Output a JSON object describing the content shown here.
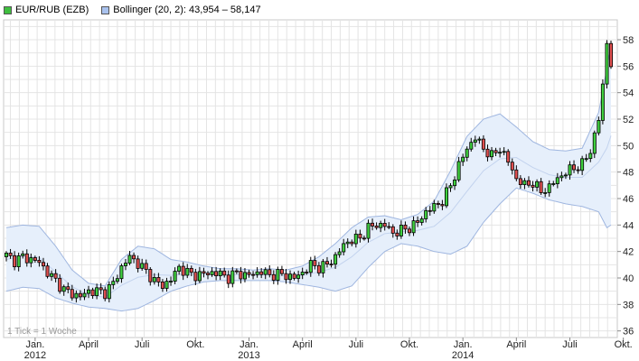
{
  "legend": {
    "series_label": "EUR/RUB (EZB)",
    "bollinger_label": "Bollinger (20, 2): 43,954 – 58,147",
    "series_color": "#3fbf3f",
    "bollinger_color": "#a9c2ee"
  },
  "footnote": "1 Tick = 1 Woche",
  "chart_data": {
    "type": "candlestick",
    "series_name": "EUR/RUB (EZB)",
    "indicator": "Bollinger (20, 2)",
    "indicator_range": [
      43.954,
      58.147
    ],
    "y_axis_side": "right",
    "ylim": [
      35.5,
      59.5
    ],
    "yticks": [
      36,
      38,
      40,
      42,
      44,
      46,
      48,
      50,
      52,
      54,
      56,
      58
    ],
    "ytick_labels": [
      "36",
      "38",
      "40",
      "42",
      "44",
      "46",
      "48",
      "50",
      "52",
      "54",
      "56",
      "58"
    ],
    "xlim": [
      0,
      147
    ],
    "xticks": [
      {
        "x": 7,
        "label": "Jan.",
        "year": "2012"
      },
      {
        "x": 20,
        "label": "April",
        "year": ""
      },
      {
        "x": 33,
        "label": "Juli",
        "year": ""
      },
      {
        "x": 46,
        "label": "Okt.",
        "year": ""
      },
      {
        "x": 59,
        "label": "Jan.",
        "year": "2013"
      },
      {
        "x": 72,
        "label": "April",
        "year": ""
      },
      {
        "x": 85,
        "label": "Juli",
        "year": ""
      },
      {
        "x": 98,
        "label": "Okt.",
        "year": ""
      },
      {
        "x": 111,
        "label": "Jan.",
        "year": "2014"
      },
      {
        "x": 124,
        "label": "April",
        "year": ""
      },
      {
        "x": 137,
        "label": "Juli",
        "year": ""
      },
      {
        "x": 150,
        "label": "Okt.",
        "year": ""
      }
    ],
    "grid": true,
    "up_color": "#3fcf3f",
    "down_color": "#e05050",
    "band_fill": "#e6effb",
    "band_edge": "#9fb6e0",
    "close_anchors": [
      [
        0,
        41.7
      ],
      [
        2,
        41.3
      ],
      [
        4,
        41.6
      ],
      [
        6,
        41.4
      ],
      [
        8,
        41.2
      ],
      [
        10,
        40.4
      ],
      [
        12,
        39.8
      ],
      [
        14,
        39.1
      ],
      [
        16,
        38.8
      ],
      [
        18,
        38.6
      ],
      [
        20,
        39.0
      ],
      [
        22,
        39.0
      ],
      [
        24,
        38.9
      ],
      [
        26,
        39.6
      ],
      [
        28,
        40.8
      ],
      [
        30,
        41.6
      ],
      [
        32,
        41.1
      ],
      [
        34,
        40.5
      ],
      [
        36,
        39.8
      ],
      [
        38,
        39.4
      ],
      [
        40,
        39.9
      ],
      [
        42,
        40.8
      ],
      [
        44,
        40.4
      ],
      [
        46,
        40.2
      ],
      [
        48,
        40.3
      ],
      [
        50,
        40.4
      ],
      [
        52,
        40.3
      ],
      [
        54,
        40.0
      ],
      [
        56,
        40.4
      ],
      [
        58,
        40.2
      ],
      [
        60,
        40.3
      ],
      [
        62,
        40.5
      ],
      [
        64,
        40.2
      ],
      [
        66,
        40.3
      ],
      [
        68,
        40.2
      ],
      [
        70,
        40.0
      ],
      [
        72,
        40.4
      ],
      [
        74,
        41.0
      ],
      [
        76,
        40.8
      ],
      [
        78,
        41.0
      ],
      [
        80,
        41.6
      ],
      [
        82,
        42.5
      ],
      [
        84,
        42.9
      ],
      [
        86,
        43.0
      ],
      [
        88,
        43.8
      ],
      [
        90,
        44.0
      ],
      [
        92,
        44.0
      ],
      [
        94,
        43.4
      ],
      [
        96,
        43.6
      ],
      [
        98,
        43.8
      ],
      [
        100,
        44.2
      ],
      [
        102,
        45.0
      ],
      [
        104,
        45.4
      ],
      [
        106,
        45.8
      ],
      [
        108,
        47.0
      ],
      [
        110,
        48.5
      ],
      [
        112,
        49.8
      ],
      [
        114,
        50.6
      ],
      [
        116,
        49.8
      ],
      [
        118,
        49.2
      ],
      [
        120,
        49.8
      ],
      [
        122,
        48.8
      ],
      [
        124,
        47.5
      ],
      [
        126,
        47.0
      ],
      [
        128,
        47.2
      ],
      [
        130,
        46.5
      ],
      [
        132,
        46.9
      ],
      [
        134,
        47.5
      ],
      [
        136,
        48.0
      ],
      [
        138,
        48.3
      ],
      [
        140,
        48.6
      ],
      [
        142,
        49.6
      ],
      [
        144,
        52.0
      ],
      [
        145,
        54.5
      ],
      [
        146,
        57.8
      ],
      [
        147,
        56.2
      ]
    ],
    "upper_band_anchors": [
      [
        0,
        43.8
      ],
      [
        4,
        44.0
      ],
      [
        8,
        43.9
      ],
      [
        12,
        42.4
      ],
      [
        16,
        40.6
      ],
      [
        20,
        39.6
      ],
      [
        24,
        39.4
      ],
      [
        28,
        41.4
      ],
      [
        32,
        42.4
      ],
      [
        36,
        42.2
      ],
      [
        40,
        41.4
      ],
      [
        44,
        41.2
      ],
      [
        48,
        40.9
      ],
      [
        52,
        40.7
      ],
      [
        56,
        40.7
      ],
      [
        60,
        40.6
      ],
      [
        64,
        40.7
      ],
      [
        68,
        40.6
      ],
      [
        72,
        40.9
      ],
      [
        76,
        41.6
      ],
      [
        80,
        42.6
      ],
      [
        84,
        43.8
      ],
      [
        88,
        44.6
      ],
      [
        92,
        44.7
      ],
      [
        96,
        44.4
      ],
      [
        100,
        44.8
      ],
      [
        104,
        45.8
      ],
      [
        108,
        48.1
      ],
      [
        112,
        50.7
      ],
      [
        116,
        52.0
      ],
      [
        120,
        52.4
      ],
      [
        124,
        51.4
      ],
      [
        128,
        50.3
      ],
      [
        132,
        49.7
      ],
      [
        136,
        49.6
      ],
      [
        140,
        49.8
      ],
      [
        144,
        52.5
      ],
      [
        147,
        57.5
      ]
    ],
    "lower_band_anchors": [
      [
        0,
        39.0
      ],
      [
        4,
        39.3
      ],
      [
        8,
        39.2
      ],
      [
        12,
        38.5
      ],
      [
        16,
        38.1
      ],
      [
        20,
        37.8
      ],
      [
        24,
        37.7
      ],
      [
        28,
        37.5
      ],
      [
        32,
        37.7
      ],
      [
        36,
        38.3
      ],
      [
        40,
        39.0
      ],
      [
        44,
        39.4
      ],
      [
        48,
        39.7
      ],
      [
        52,
        39.8
      ],
      [
        56,
        39.8
      ],
      [
        60,
        39.8
      ],
      [
        64,
        39.8
      ],
      [
        68,
        39.7
      ],
      [
        72,
        39.5
      ],
      [
        76,
        39.3
      ],
      [
        80,
        39.0
      ],
      [
        84,
        39.4
      ],
      [
        88,
        40.8
      ],
      [
        92,
        42.0
      ],
      [
        96,
        42.6
      ],
      [
        100,
        42.4
      ],
      [
        104,
        42.0
      ],
      [
        108,
        41.8
      ],
      [
        112,
        42.4
      ],
      [
        116,
        44.2
      ],
      [
        120,
        45.6
      ],
      [
        124,
        46.8
      ],
      [
        128,
        46.4
      ],
      [
        132,
        45.9
      ],
      [
        136,
        45.6
      ],
      [
        140,
        45.4
      ],
      [
        144,
        45.0
      ],
      [
        146,
        43.8
      ],
      [
        147,
        44.0
      ]
    ]
  }
}
